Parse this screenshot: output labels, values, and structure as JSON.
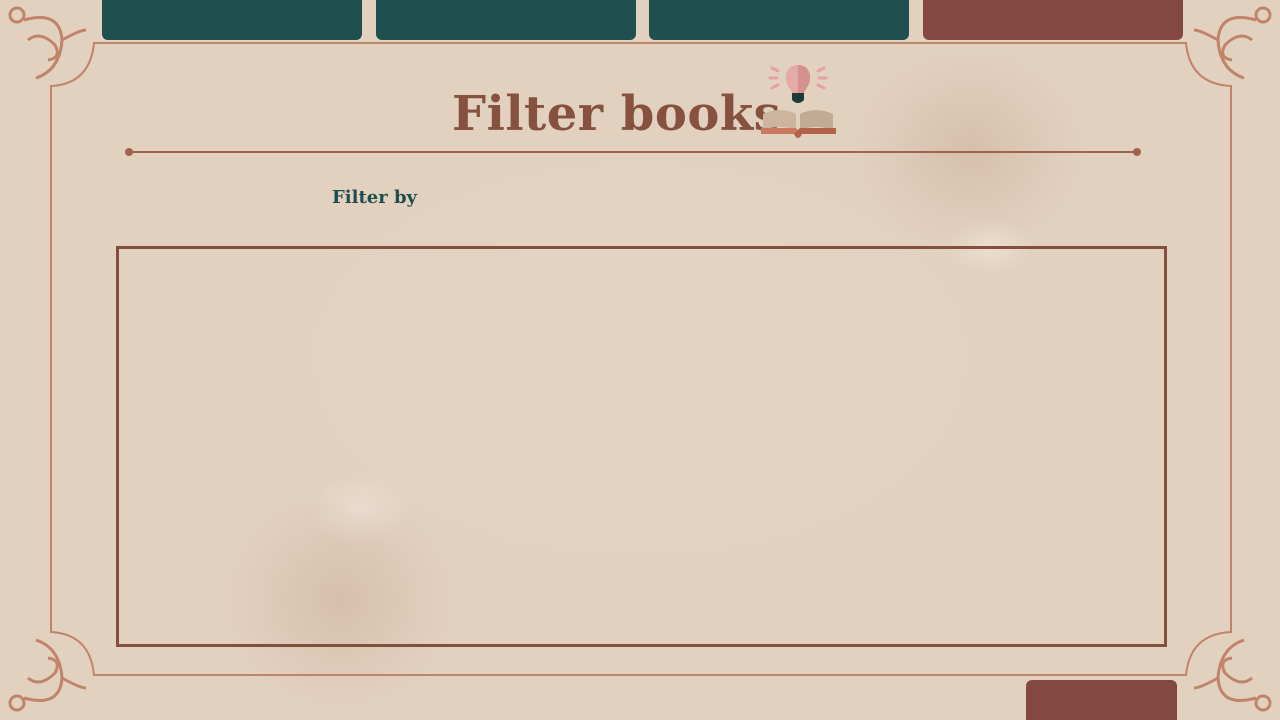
{
  "page": {
    "title": "Filter books",
    "filter_label": "Filter by"
  },
  "tabs": [
    {
      "label": "",
      "color": "#204f4f"
    },
    {
      "label": "",
      "color": "#204f4f"
    },
    {
      "label": "",
      "color": "#204f4f"
    },
    {
      "label": "",
      "color": "#834841"
    }
  ],
  "next_button": {
    "label": "",
    "color": "#834841"
  },
  "icons": {
    "header_icon": "lightbulb-book-icon",
    "corner_ornament": "flourish-corner-icon"
  },
  "colors": {
    "background": "#e3d1c0",
    "title": "#86513f",
    "label": "#1f4e4e",
    "accent_green": "#204f4f",
    "accent_red": "#834841",
    "border": "#83503f"
  }
}
